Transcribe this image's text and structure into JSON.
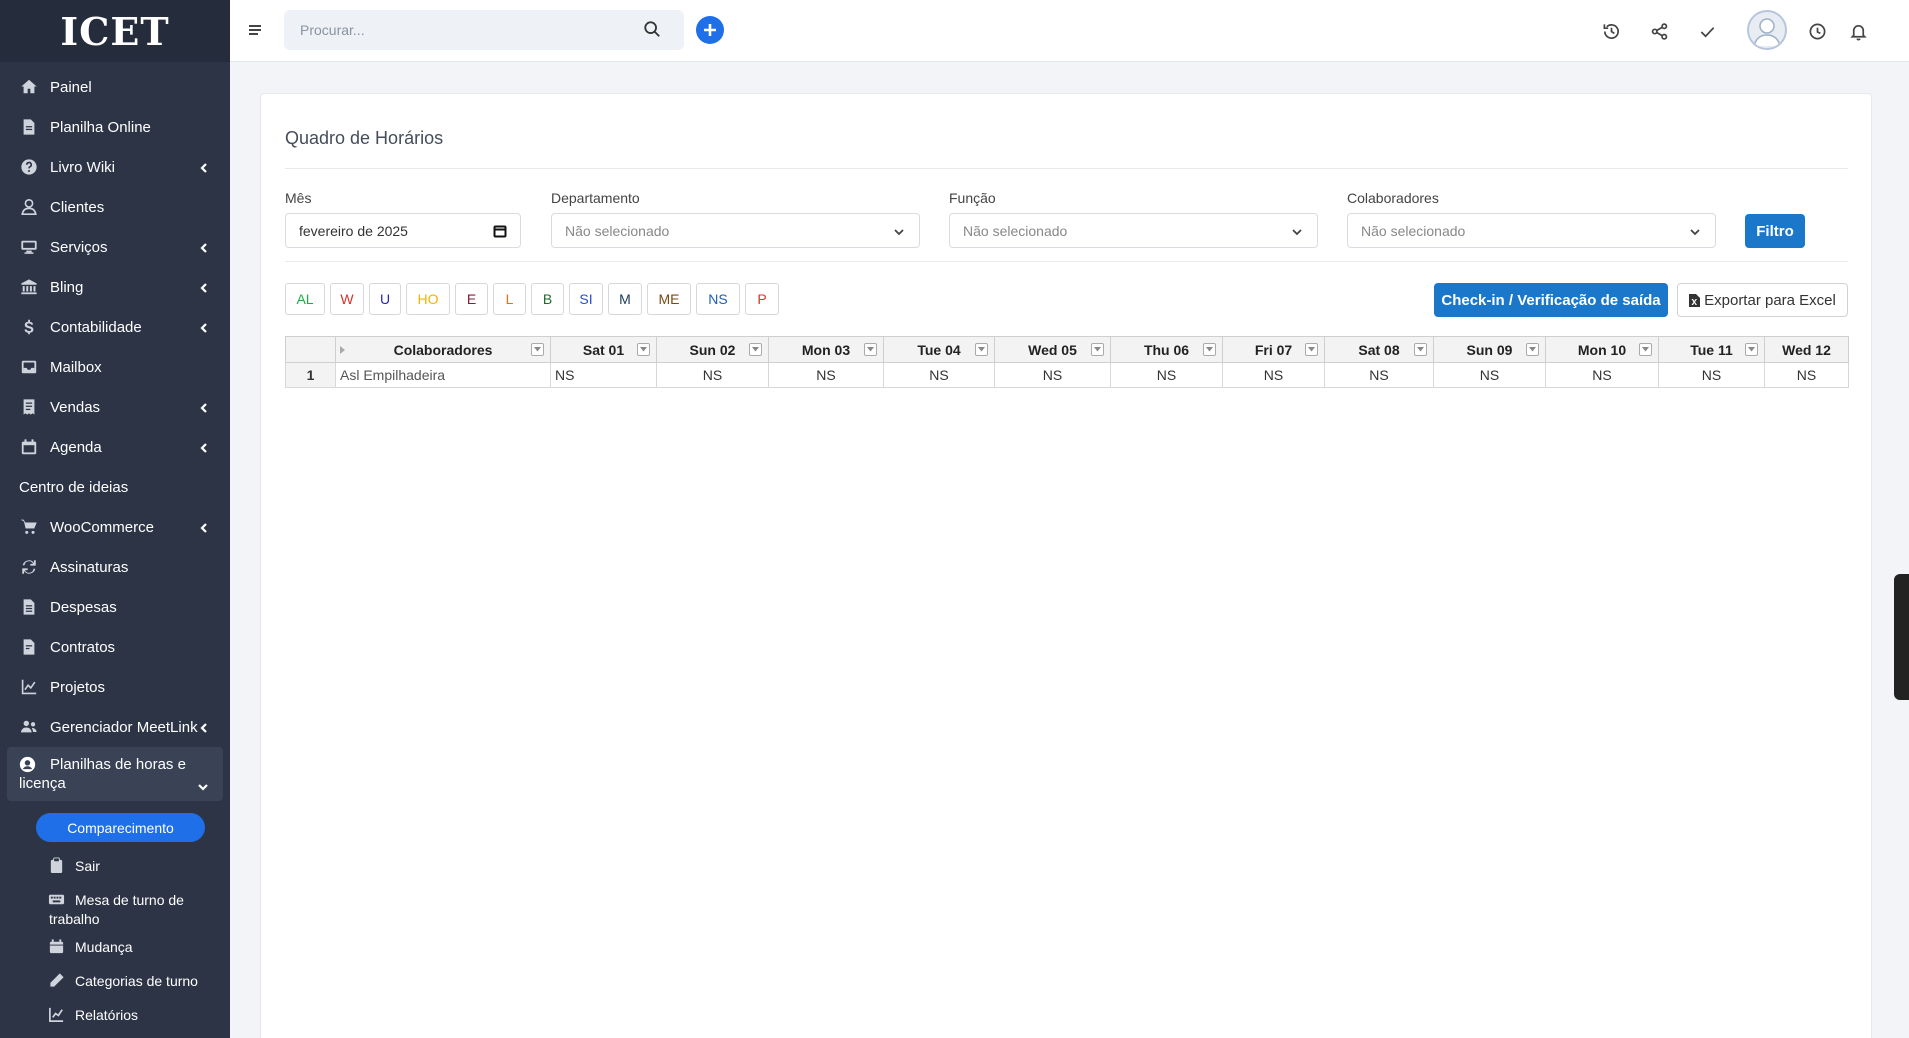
{
  "logo": "ICET",
  "sidebar": {
    "items": [
      {
        "label": "Painel",
        "icon": "home-icon",
        "chevron": false
      },
      {
        "label": "Planilha Online",
        "icon": "file-icon",
        "chevron": false
      },
      {
        "label": "Livro Wiki",
        "icon": "question-circle-icon",
        "chevron": true
      },
      {
        "label": "Clientes",
        "icon": "user-icon",
        "chevron": false
      },
      {
        "label": "Serviços",
        "icon": "services-icon",
        "chevron": true
      },
      {
        "label": "Bling",
        "icon": "bank-icon",
        "chevron": true
      },
      {
        "label": "Contabilidade",
        "icon": "dollar-icon",
        "chevron": true
      },
      {
        "label": "Mailbox",
        "icon": "mailbox-icon",
        "chevron": false
      },
      {
        "label": "Vendas",
        "icon": "receipt-icon",
        "chevron": true
      },
      {
        "label": "Agenda",
        "icon": "calendar-icon",
        "chevron": true
      },
      {
        "label": "Centro de ideias",
        "icon": "",
        "chevron": false
      },
      {
        "label": "WooCommerce",
        "icon": "cart-icon",
        "chevron": true
      },
      {
        "label": "Assinaturas",
        "icon": "refresh-icon",
        "chevron": false
      },
      {
        "label": "Despesas",
        "icon": "document-icon",
        "chevron": false
      },
      {
        "label": "Contratos",
        "icon": "contract-icon",
        "chevron": false
      },
      {
        "label": "Projetos",
        "icon": "chart-icon",
        "chevron": false
      },
      {
        "label": "Gerenciador MeetLink",
        "icon": "users-icon",
        "chevron": true
      }
    ],
    "open_group": {
      "label_line1": "Planilhas de horas e",
      "label_line2": "licença"
    },
    "submenu": {
      "active": "Comparecimento",
      "items": [
        {
          "label": "Sair",
          "icon": "clipboard-icon"
        },
        {
          "label_line1": "Mesa de turno de",
          "label_line2": "trabalho",
          "icon": "keyboard-icon"
        },
        {
          "label": "Mudança",
          "icon": "calendar-small-icon"
        },
        {
          "label": "Categorias de turno",
          "icon": "pencil-icon"
        },
        {
          "label": "Relatórios",
          "icon": "line-chart-icon"
        }
      ]
    }
  },
  "topbar": {
    "search_placeholder": "Procurar..."
  },
  "page": {
    "title": "Quadro de Horários",
    "filters": {
      "month_label": "Mês",
      "month_value": "fevereiro de 2025",
      "department_label": "Departamento",
      "department_value": "Não selecionado",
      "role_label": "Função",
      "role_value": "Não selecionado",
      "employees_label": "Colaboradores",
      "employees_value": "Não selecionado",
      "filter_button": "Filtro"
    },
    "legend": [
      {
        "code": "AL",
        "color": "#28a745"
      },
      {
        "code": "W",
        "color": "#d9342b"
      },
      {
        "code": "U",
        "color": "#2a2ab0"
      },
      {
        "code": "HO",
        "color": "#f0b400"
      },
      {
        "code": "E",
        "color": "#8b1a3a"
      },
      {
        "code": "L",
        "color": "#e5701a"
      },
      {
        "code": "B",
        "color": "#1f6b2e"
      },
      {
        "code": "SI",
        "color": "#2b4fd0"
      },
      {
        "code": "M",
        "color": "#1a3a5a"
      },
      {
        "code": "ME",
        "color": "#7a4a10"
      },
      {
        "code": "NS",
        "color": "#1f5fb0"
      },
      {
        "code": "P",
        "color": "#d9342b"
      }
    ],
    "checkin_button": "Check-in / Verificação de saída",
    "export_button": "Exportar para Excel",
    "grid": {
      "headers": [
        "Colaboradores",
        "Sat 01",
        "Sun 02",
        "Mon 03",
        "Tue 04",
        "Wed 05",
        "Thu 06",
        "Fri 07",
        "Sat 08",
        "Sun 09",
        "Mon 10",
        "Tue 11",
        "Wed 12"
      ],
      "rows": [
        {
          "num": "1",
          "name": "Asl Empilhadeira",
          "cells": [
            "NS",
            "NS",
            "NS",
            "NS",
            "NS",
            "NS",
            "NS",
            "NS",
            "NS",
            "NS",
            "NS",
            "NS"
          ]
        }
      ]
    }
  },
  "colors": {
    "sidebar_bg": "#2c3446",
    "accent": "#1e6fe8",
    "primary_button": "#1b77c9"
  }
}
